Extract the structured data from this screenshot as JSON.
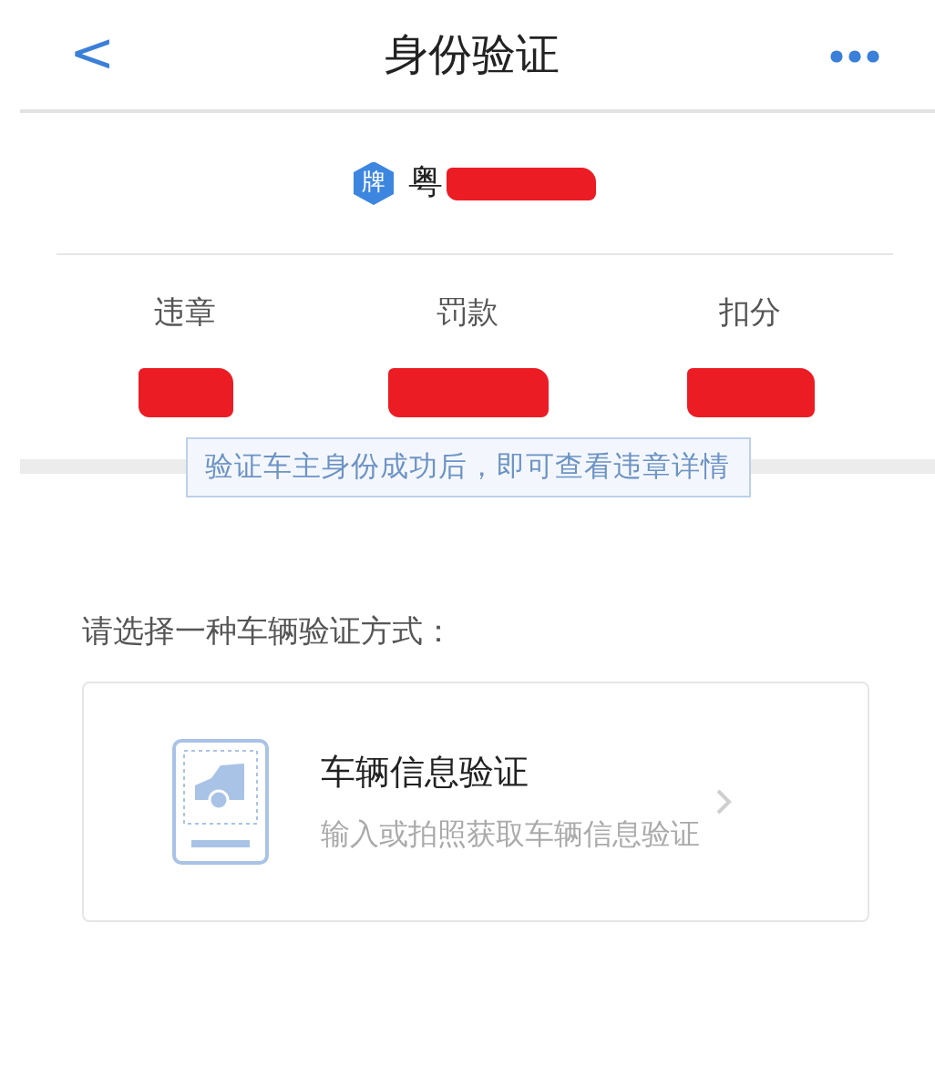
{
  "header": {
    "back": "<",
    "title": "身份验证"
  },
  "plate": {
    "badge": "牌",
    "province": "粤",
    "redacted": true
  },
  "stats": [
    {
      "label": "违章",
      "redacted": true
    },
    {
      "label": "罚款",
      "redacted": true
    },
    {
      "label": "扣分",
      "redacted": true
    }
  ],
  "notice": "验证车主身份成功后，即可查看违章详情",
  "prompt": "请选择一种车辆验证方式：",
  "options": [
    {
      "title": "车辆信息验证",
      "subtitle": "输入或拍照获取车辆信息验证"
    }
  ]
}
